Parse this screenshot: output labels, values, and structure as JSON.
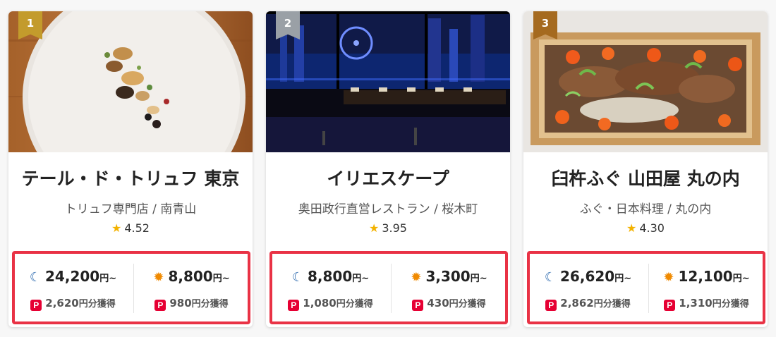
{
  "cards": [
    {
      "rank": "1",
      "name": "テール・ド・トリュフ 東京",
      "genre": "トリュフ専門店 / 南青山",
      "rating": "4.52",
      "dinner_price": "24,200",
      "lunch_price": "8,800",
      "dinner_points": "2,620",
      "lunch_points": "980"
    },
    {
      "rank": "2",
      "name": "イリエスケープ",
      "genre": "奥田政行直営レストラン / 桜木町",
      "rating": "3.95",
      "dinner_price": "8,800",
      "lunch_price": "3,300",
      "dinner_points": "1,080",
      "lunch_points": "430"
    },
    {
      "rank": "3",
      "name": "臼杵ふぐ 山田屋 丸の内",
      "genre": "ふぐ・日本料理 / 丸の内",
      "rating": "4.30",
      "dinner_price": "26,620",
      "lunch_price": "12,100",
      "dinner_points": "2,862",
      "lunch_points": "1,310"
    }
  ],
  "labels": {
    "price_unit": "円~",
    "points_unit": "円分獲得",
    "paypay_mark": "P"
  },
  "icons": {
    "dinner": "moon-icon",
    "lunch": "sun-icon",
    "rating": "star-icon",
    "points": "paypay-icon"
  },
  "colors": {
    "highlight_border": "#e93245",
    "paypay_red": "#e60033",
    "star": "#f3b200",
    "moon": "#2e6bb0",
    "sun": "#f08a00",
    "rank_gold": "#c39b2c",
    "rank_silver": "#9aa0a6",
    "rank_bronze": "#a56a1f"
  }
}
